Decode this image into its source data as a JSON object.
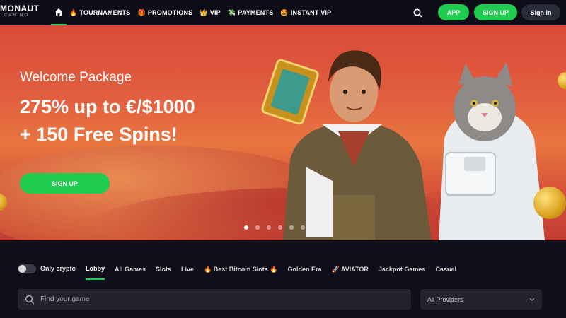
{
  "header": {
    "logo": {
      "word": "MONAUT",
      "sub": "CASINO"
    },
    "nav": [
      {
        "label": "TOURNAMENTS",
        "icon": "fire-icon",
        "glyph": "🔥"
      },
      {
        "label": "PROMOTIONS",
        "icon": "gift-icon",
        "glyph": "🎁"
      },
      {
        "label": "VIP",
        "icon": "crown-icon",
        "glyph": "👑"
      },
      {
        "label": "PAYMENTS",
        "icon": "payment-icon",
        "glyph": "💸"
      },
      {
        "label": "INSTANT VIP",
        "icon": "star-face-icon",
        "glyph": "🤩"
      }
    ],
    "app_label": "APP",
    "signup_label": "SIGN UP",
    "signin_label": "Sign In"
  },
  "hero": {
    "subtitle": "Welcome Package",
    "title_line1": "275% up to €/$1000",
    "title_line2": "+ 150 Free Spins!",
    "button_label": "SIGN UP",
    "slide_count": 6,
    "active_slide": 1
  },
  "filters": {
    "only_crypto_label": "Only crypto",
    "tabs": [
      {
        "label": "Lobby",
        "active": true
      },
      {
        "label": "All Games"
      },
      {
        "label": "Slots"
      },
      {
        "label": "Live"
      },
      {
        "label": "🔥 Best Bitcoin Slots 🔥"
      },
      {
        "label": "Golden Era"
      },
      {
        "label": "🚀 AVIATOR"
      },
      {
        "label": "Jackpot Games"
      },
      {
        "label": "Casual"
      }
    ],
    "search_placeholder": "Find your game",
    "providers_label": "All Providers"
  },
  "colors": {
    "accent": "#1fcc4f",
    "background": "#0e0f1a"
  }
}
